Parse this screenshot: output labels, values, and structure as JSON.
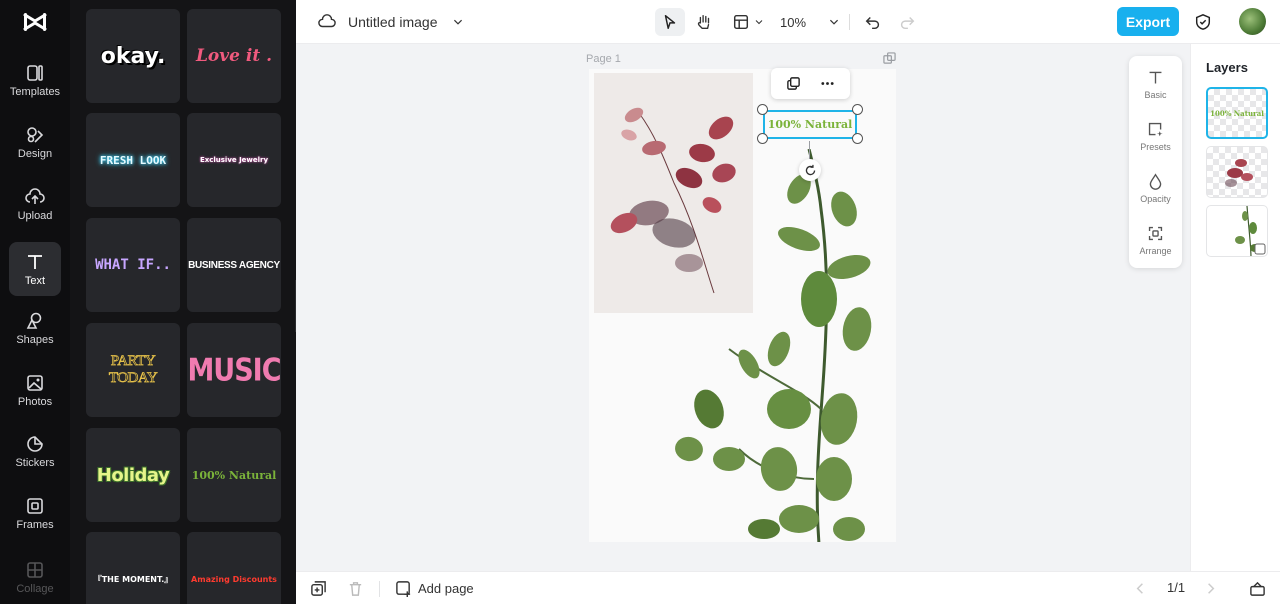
{
  "sidebar": {
    "items": [
      {
        "label": "Templates",
        "icon": "templates-icon"
      },
      {
        "label": "Design",
        "icon": "design-icon"
      },
      {
        "label": "Upload",
        "icon": "upload-icon"
      },
      {
        "label": "Text",
        "icon": "text-icon",
        "active": true
      },
      {
        "label": "Shapes",
        "icon": "shapes-icon"
      },
      {
        "label": "Photos",
        "icon": "photos-icon"
      },
      {
        "label": "Stickers",
        "icon": "stickers-icon"
      },
      {
        "label": "Frames",
        "icon": "frames-icon"
      },
      {
        "label": "Collage",
        "icon": "collage-icon"
      }
    ]
  },
  "text_presets": [
    {
      "text": "okay.",
      "color": "#ffffff"
    },
    {
      "text": "Love it .",
      "color": "#f05a7e"
    },
    {
      "text": "FRESH LOOK",
      "color": "#bdf3ff"
    },
    {
      "text": "Exclusive Jewelry",
      "color": "#ffffff"
    },
    {
      "text": "WHAT IF..",
      "color": "#c7a6ff"
    },
    {
      "text": "BUSINESS AGENCY",
      "color": "#ffffff"
    },
    {
      "text": "PARTY TODAY",
      "color": "#e8c34a"
    },
    {
      "text": "MUSIC",
      "color": "#f07bb0"
    },
    {
      "text": "Holiday",
      "color": "#e6f58a"
    },
    {
      "text": "100% Natural",
      "color": "#7bb33a"
    },
    {
      "text": "『THE MOMENT.』",
      "color": "#ffffff"
    },
    {
      "text": "Amazing Discounts",
      "color": "#ff3b2f"
    }
  ],
  "topbar": {
    "doc_title": "Untitled image",
    "zoom": "10%",
    "export_label": "Export"
  },
  "canvas": {
    "page_label": "Page 1",
    "selected_text": "100% Natural",
    "accent_color": "#1fb4e8"
  },
  "tools": [
    {
      "label": "Basic",
      "icon": "text-icon"
    },
    {
      "label": "Presets",
      "icon": "presets-icon"
    },
    {
      "label": "Opacity",
      "icon": "opacity-icon"
    },
    {
      "label": "Arrange",
      "icon": "arrange-icon"
    }
  ],
  "layers": {
    "title": "Layers",
    "items": [
      {
        "thumb_text": "100% Natural",
        "selected": true
      },
      {
        "thumb_text": "",
        "selected": false
      },
      {
        "thumb_text": "",
        "selected": false
      }
    ]
  },
  "bottombar": {
    "add_page_label": "Add page",
    "page_counter": "1/1"
  }
}
